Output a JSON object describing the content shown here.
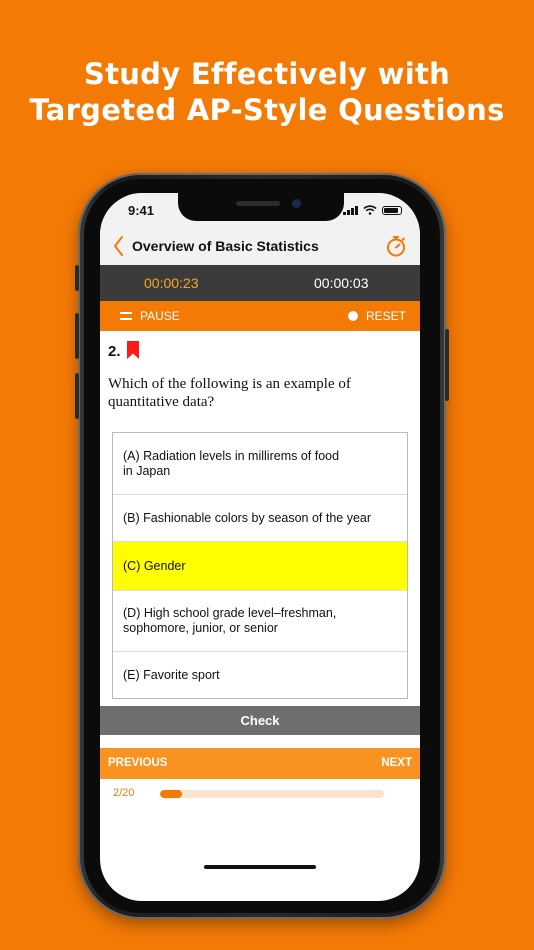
{
  "promo": {
    "headline_line1": "Study Effectively with",
    "headline_line2": "Targeted AP-Style Questions"
  },
  "status_bar": {
    "time": "9:41"
  },
  "nav": {
    "title": "Overview of Basic Statistics",
    "back_icon": "chevron-left-icon",
    "right_icon": "stopwatch-icon"
  },
  "timers": {
    "total": "00:00:23",
    "question": "00:00:03"
  },
  "controls": {
    "pause_label": "PAUSE",
    "reset_label": "RESET"
  },
  "question": {
    "number": "2.",
    "text": "Which of the following is an example of quantitative data?",
    "bookmarked": true
  },
  "options": [
    {
      "label": "(A) Radiation levels in millirems of food in Japan",
      "selected": false
    },
    {
      "label": "(B) Fashionable colors by season of the year",
      "selected": false
    },
    {
      "label": "(C) Gender",
      "selected": true
    },
    {
      "label": "(D) High school grade level–freshman, sophomore, junior, or senior",
      "selected": false
    },
    {
      "label": "(E) Favorite sport",
      "selected": false
    }
  ],
  "check_label": "Check",
  "pager": {
    "previous_label": "PREVIOUS",
    "next_label": "NEXT"
  },
  "progress": {
    "label": "2/20",
    "fraction": 0.1
  },
  "colors": {
    "accent": "#f47a06",
    "selected_bg": "#ffff00",
    "timer_bar": "#3b3b3b"
  }
}
